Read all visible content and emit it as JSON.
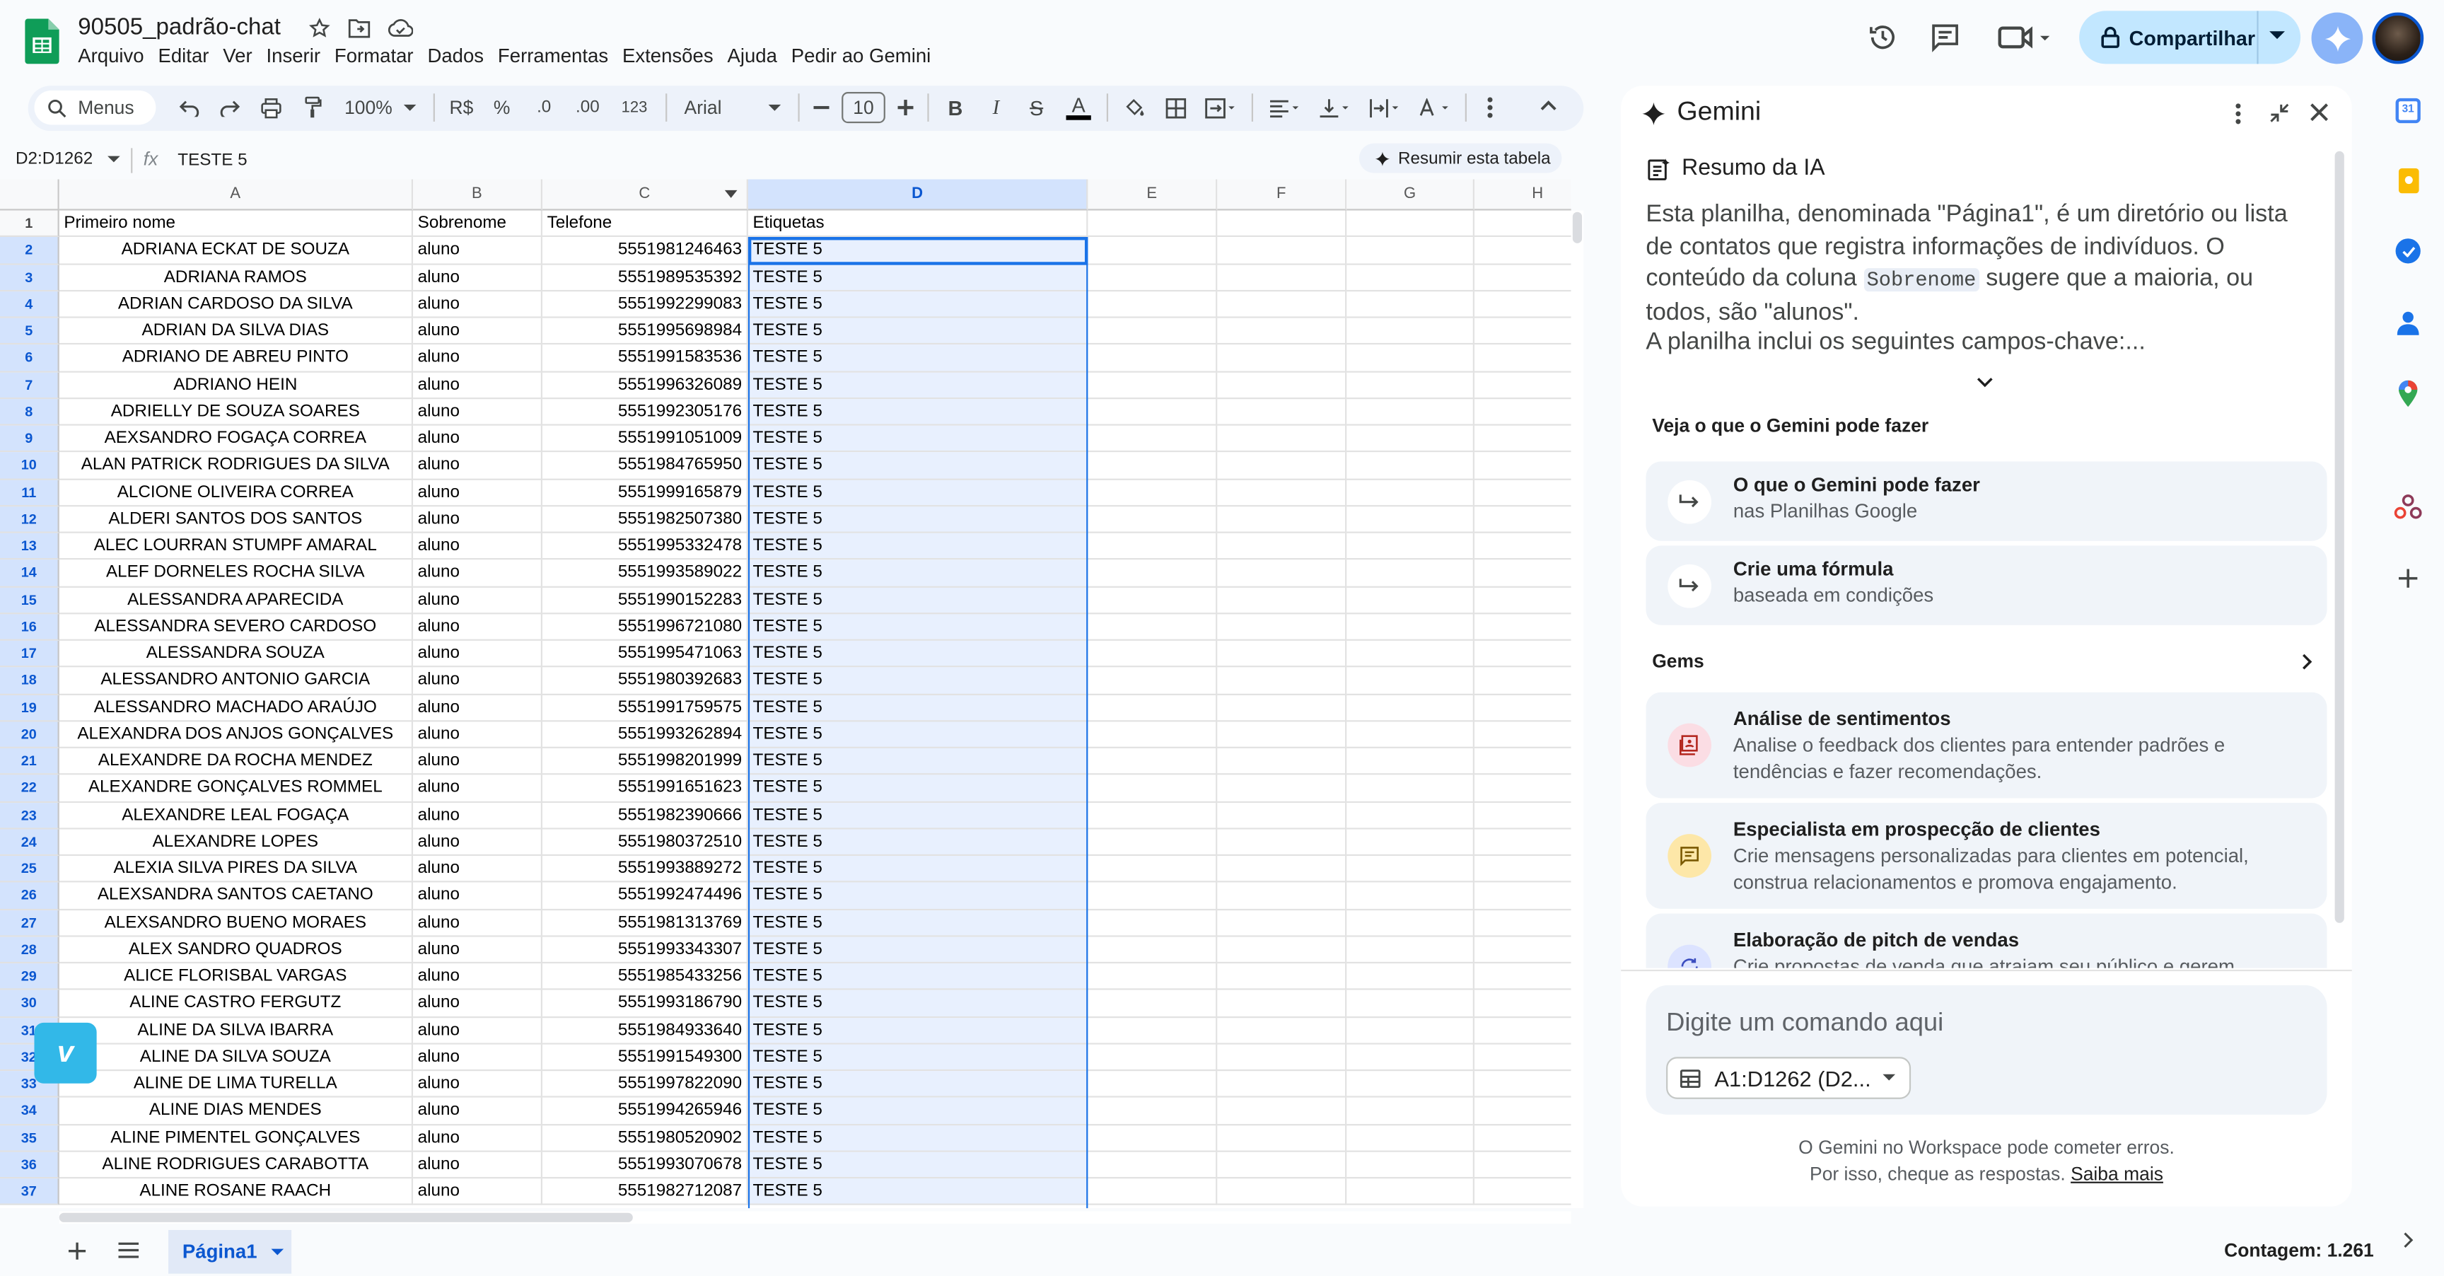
{
  "app": {
    "doc_title": "90505_padrão-chat",
    "menu": [
      "Arquivo",
      "Editar",
      "Ver",
      "Inserir",
      "Formatar",
      "Dados",
      "Ferramentas",
      "Extensões",
      "Ajuda",
      "Pedir ao Gemini"
    ],
    "share_label": "Compartilhar"
  },
  "toolbar": {
    "menus_label": "Menus",
    "zoom": "100%",
    "currency": "R$",
    "percent": "%",
    "dec_less": ".0",
    "dec_more": ".00",
    "number_format": "123",
    "font": "Arial",
    "font_size": "10"
  },
  "formula": {
    "name_box": "D2:D1262",
    "fx": "fx",
    "content": "TESTE 5",
    "summarize": "Resumir esta tabela"
  },
  "grid": {
    "columns": [
      "A",
      "B",
      "C",
      "D",
      "E",
      "F",
      "G",
      "H"
    ],
    "header_row": [
      "Primeiro nome",
      "Sobrenome",
      "Telefone",
      "Etiquetas"
    ],
    "row_numbers": [
      "1",
      "2",
      "3",
      "4",
      "5",
      "6",
      "7",
      "8",
      "9",
      "10",
      "11",
      "12",
      "13",
      "14",
      "15",
      "16",
      "17",
      "18",
      "19",
      "20",
      "21",
      "22",
      "23",
      "24",
      "25",
      "26",
      "27",
      "28",
      "29",
      "30",
      "31",
      "32",
      "33",
      "34",
      "35",
      "36",
      "37"
    ],
    "rows": [
      [
        "ADRIANA ECKAT DE SOUZA",
        "aluno",
        "5551981246463",
        "TESTE 5"
      ],
      [
        "ADRIANA RAMOS",
        "aluno",
        "5551989535392",
        "TESTE 5"
      ],
      [
        "ADRIAN CARDOSO DA SILVA",
        "aluno",
        "5551992299083",
        "TESTE 5"
      ],
      [
        "ADRIAN DA SILVA DIAS",
        "aluno",
        "5551995698984",
        "TESTE 5"
      ],
      [
        "ADRIANO DE ABREU PINTO",
        "aluno",
        "5551991583536",
        "TESTE 5"
      ],
      [
        "ADRIANO HEIN",
        "aluno",
        "5551996326089",
        "TESTE 5"
      ],
      [
        "ADRIELLY DE SOUZA SOARES",
        "aluno",
        "5551992305176",
        "TESTE 5"
      ],
      [
        "AEXSANDRO FOGAÇA CORREA",
        "aluno",
        "5551991051009",
        "TESTE 5"
      ],
      [
        "ALAN PATRICK RODRIGUES DA SILVA",
        "aluno",
        "5551984765950",
        "TESTE 5"
      ],
      [
        "ALCIONE OLIVEIRA CORREA",
        "aluno",
        "5551999165879",
        "TESTE 5"
      ],
      [
        "ALDERI SANTOS DOS SANTOS",
        "aluno",
        "5551982507380",
        "TESTE 5"
      ],
      [
        "ALEC LOURRAN STUMPF AMARAL",
        "aluno",
        "5551995332478",
        "TESTE 5"
      ],
      [
        "ALEF DORNELES ROCHA SILVA",
        "aluno",
        "5551993589022",
        "TESTE 5"
      ],
      [
        "ALESSANDRA APARECIDA",
        "aluno",
        "5551990152283",
        "TESTE 5"
      ],
      [
        "ALESSANDRA SEVERO CARDOSO",
        "aluno",
        "5551996721080",
        "TESTE 5"
      ],
      [
        "ALESSANDRA SOUZA",
        "aluno",
        "5551995471063",
        "TESTE 5"
      ],
      [
        "ALESSANDRO ANTONIO GARCIA",
        "aluno",
        "5551980392683",
        "TESTE 5"
      ],
      [
        "ALESSANDRO MACHADO ARAÚJO",
        "aluno",
        "5551991759575",
        "TESTE 5"
      ],
      [
        "ALEXANDRA DOS ANJOS GONÇALVES",
        "aluno",
        "5551993262894",
        "TESTE 5"
      ],
      [
        "ALEXANDRE DA ROCHA MENDEZ",
        "aluno",
        "5551998201999",
        "TESTE 5"
      ],
      [
        "ALEXANDRE GONÇALVES ROMMEL",
        "aluno",
        "5551991651623",
        "TESTE 5"
      ],
      [
        "ALEXANDRE LEAL FOGAÇA",
        "aluno",
        "5551982390666",
        "TESTE 5"
      ],
      [
        "ALEXANDRE LOPES",
        "aluno",
        "5551980372510",
        "TESTE 5"
      ],
      [
        "ALEXIA SILVA PIRES DA SILVA",
        "aluno",
        "5551993889272",
        "TESTE 5"
      ],
      [
        "ALEXSANDRA SANTOS CAETANO",
        "aluno",
        "5551992474496",
        "TESTE 5"
      ],
      [
        "ALEXSANDRO BUENO MORAES",
        "aluno",
        "5551981313769",
        "TESTE 5"
      ],
      [
        "ALEX SANDRO QUADROS",
        "aluno",
        "5551993343307",
        "TESTE 5"
      ],
      [
        "ALICE FLORISBAL VARGAS",
        "aluno",
        "5551985433256",
        "TESTE 5"
      ],
      [
        "ALINE CASTRO FERGUTZ",
        "aluno",
        "5551993186790",
        "TESTE 5"
      ],
      [
        "ALINE DA SILVA IBARRA",
        "aluno",
        "5551984933640",
        "TESTE 5"
      ],
      [
        "ALINE DA SILVA SOUZA",
        "aluno",
        "5551991549300",
        "TESTE 5"
      ],
      [
        "ALINE DE LIMA TURELLA",
        "aluno",
        "5551997822090",
        "TESTE 5"
      ],
      [
        "ALINE DIAS MENDES",
        "aluno",
        "5551994265946",
        "TESTE 5"
      ],
      [
        "ALINE PIMENTEL GONÇALVES",
        "aluno",
        "5551980520902",
        "TESTE 5"
      ],
      [
        "ALINE RODRIGUES CARABOTTA",
        "aluno",
        "5551993070678",
        "TESTE 5"
      ],
      [
        "ALINE ROSANE RAACH",
        "aluno",
        "5551982712087",
        "TESTE 5"
      ]
    ]
  },
  "bottom": {
    "sheet_tab": "Página1",
    "count": "Contagem: 1.261"
  },
  "gemini": {
    "title": "Gemini",
    "summary_title": "Resumo da IA",
    "summary_p1_a": "Esta planilha, denominada \"Página1\", é um diretório ou lista de contatos que registra informações de indivíduos. O conteúdo da coluna ",
    "summary_code": "Sobrenome",
    "summary_p1_b": " sugere que a maioria, ou todos, são \"alunos\".",
    "summary_p2": "A planilha inclui os seguintes campos-chave:...",
    "see_label": "Veja o que o Gemini pode fazer",
    "suggestions": [
      {
        "title": "O que o Gemini pode fazer",
        "sub": "nas Planilhas Google"
      },
      {
        "title": "Crie uma fórmula",
        "sub": "baseada em condições"
      }
    ],
    "gems_label": "Gems",
    "gems": [
      {
        "title": "Análise de sentimentos",
        "sub": "Analise o feedback dos clientes para entender padrões e tendências e fazer recomendações."
      },
      {
        "title": "Especialista em prospecção de clientes",
        "sub": "Crie mensagens personalizadas para clientes em potencial, construa relacionamentos e promova engajamento."
      },
      {
        "title": "Elaboração de pitch de vendas",
        "sub": "Crie propostas de venda que atraiam seu público e gerem"
      }
    ],
    "input_placeholder": "Digite um comando aqui",
    "range_chip": "A1:D1262 (D2...",
    "disclaimer_1": "O Gemini no Workspace pode cometer erros.",
    "disclaimer_2": "Por isso, cheque as respostas.",
    "learn_more": "Saiba mais"
  },
  "colors": {
    "accent": "#0b57d0",
    "share_bg": "#c2e7ff",
    "selection": "#e8f0fe",
    "header_selected": "#d3e3fd"
  }
}
